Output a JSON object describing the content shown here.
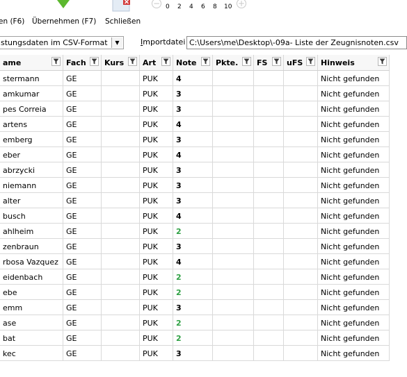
{
  "toolbar": {
    "btn1_label": "en (F6)",
    "btn2_label": "Übernehmen (F7)",
    "btn3_label": "Schließen",
    "zoom_minus": "−",
    "zoom_plus": "+",
    "zoom_ticks": [
      "0",
      "2",
      "4",
      "6",
      "8",
      "10"
    ]
  },
  "format": {
    "selected": "stungsdaten im CSV-Format"
  },
  "import": {
    "label": "Importdatei",
    "path": "C:\\Users\\me\\Desktop\\-09a- Liste der Zeugnisnoten.csv"
  },
  "colors": {
    "note_green": "#2ea043",
    "accent_green": "#5cb82e",
    "close_red": "#d23b3b"
  },
  "table": {
    "headers": [
      "ame",
      "Fach",
      "Kurs",
      "Art",
      "Note",
      "Pkte.",
      "FS",
      "uFS",
      "Hinweis"
    ],
    "rows": [
      {
        "name": "stermann",
        "fach": "GE",
        "kurs": "",
        "art": "PUK",
        "note": "4",
        "pkte": "",
        "fs": "",
        "ufs": "",
        "hinweis": "Nicht gefunden",
        "note_color": "black"
      },
      {
        "name": "amkumar",
        "fach": "GE",
        "kurs": "",
        "art": "PUK",
        "note": "3",
        "pkte": "",
        "fs": "",
        "ufs": "",
        "hinweis": "Nicht gefunden",
        "note_color": "black"
      },
      {
        "name": "pes Correia",
        "fach": "GE",
        "kurs": "",
        "art": "PUK",
        "note": "3",
        "pkte": "",
        "fs": "",
        "ufs": "",
        "hinweis": "Nicht gefunden",
        "note_color": "black"
      },
      {
        "name": "artens",
        "fach": "GE",
        "kurs": "",
        "art": "PUK",
        "note": "4",
        "pkte": "",
        "fs": "",
        "ufs": "",
        "hinweis": "Nicht gefunden",
        "note_color": "black"
      },
      {
        "name": "emberg",
        "fach": "GE",
        "kurs": "",
        "art": "PUK",
        "note": "3",
        "pkte": "",
        "fs": "",
        "ufs": "",
        "hinweis": "Nicht gefunden",
        "note_color": "black"
      },
      {
        "name": "eber",
        "fach": "GE",
        "kurs": "",
        "art": "PUK",
        "note": "4",
        "pkte": "",
        "fs": "",
        "ufs": "",
        "hinweis": "Nicht gefunden",
        "note_color": "black"
      },
      {
        "name": "abrzycki",
        "fach": "GE",
        "kurs": "",
        "art": "PUK",
        "note": "3",
        "pkte": "",
        "fs": "",
        "ufs": "",
        "hinweis": "Nicht gefunden",
        "note_color": "black"
      },
      {
        "name": "niemann",
        "fach": "GE",
        "kurs": "",
        "art": "PUK",
        "note": "3",
        "pkte": "",
        "fs": "",
        "ufs": "",
        "hinweis": "Nicht gefunden",
        "note_color": "black"
      },
      {
        "name": "alter",
        "fach": "GE",
        "kurs": "",
        "art": "PUK",
        "note": "3",
        "pkte": "",
        "fs": "",
        "ufs": "",
        "hinweis": "Nicht gefunden",
        "note_color": "black"
      },
      {
        "name": "busch",
        "fach": "GE",
        "kurs": "",
        "art": "PUK",
        "note": "4",
        "pkte": "",
        "fs": "",
        "ufs": "",
        "hinweis": "Nicht gefunden",
        "note_color": "black"
      },
      {
        "name": "ahlheim",
        "fach": "GE",
        "kurs": "",
        "art": "PUK",
        "note": "2",
        "pkte": "",
        "fs": "",
        "ufs": "",
        "hinweis": "Nicht gefunden",
        "note_color": "green"
      },
      {
        "name": "zenbraun",
        "fach": "GE",
        "kurs": "",
        "art": "PUK",
        "note": "3",
        "pkte": "",
        "fs": "",
        "ufs": "",
        "hinweis": "Nicht gefunden",
        "note_color": "black"
      },
      {
        "name": "rbosa Vazquez",
        "fach": "GE",
        "kurs": "",
        "art": "PUK",
        "note": "4",
        "pkte": "",
        "fs": "",
        "ufs": "",
        "hinweis": "Nicht gefunden",
        "note_color": "black"
      },
      {
        "name": "eidenbach",
        "fach": "GE",
        "kurs": "",
        "art": "PUK",
        "note": "2",
        "pkte": "",
        "fs": "",
        "ufs": "",
        "hinweis": "Nicht gefunden",
        "note_color": "green"
      },
      {
        "name": "ebe",
        "fach": "GE",
        "kurs": "",
        "art": "PUK",
        "note": "2",
        "pkte": "",
        "fs": "",
        "ufs": "",
        "hinweis": "Nicht gefunden",
        "note_color": "green"
      },
      {
        "name": "emm",
        "fach": "GE",
        "kurs": "",
        "art": "PUK",
        "note": "3",
        "pkte": "",
        "fs": "",
        "ufs": "",
        "hinweis": "Nicht gefunden",
        "note_color": "black"
      },
      {
        "name": "ase",
        "fach": "GE",
        "kurs": "",
        "art": "PUK",
        "note": "2",
        "pkte": "",
        "fs": "",
        "ufs": "",
        "hinweis": "Nicht gefunden",
        "note_color": "green"
      },
      {
        "name": "bat",
        "fach": "GE",
        "kurs": "",
        "art": "PUK",
        "note": "2",
        "pkte": "",
        "fs": "",
        "ufs": "",
        "hinweis": "Nicht gefunden",
        "note_color": "green"
      },
      {
        "name": "kec",
        "fach": "GE",
        "kurs": "",
        "art": "PUK",
        "note": "3",
        "pkte": "",
        "fs": "",
        "ufs": "",
        "hinweis": "Nicht gefunden",
        "note_color": "black"
      }
    ]
  }
}
